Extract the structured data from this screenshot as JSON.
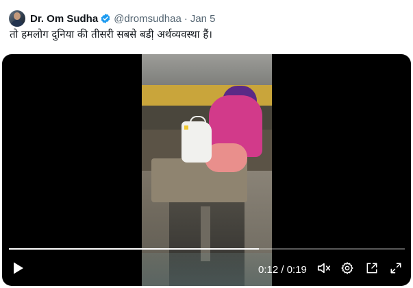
{
  "tweet": {
    "author_name": "Dr. Om Sudha",
    "handle": "@dromsudhaa",
    "separator": "·",
    "date": "Jan 5",
    "text": "तो हमलोग दुनिया की तीसरी सबसे बडी़ अर्थव्यवस्था हैं।"
  },
  "player": {
    "current_time": "0:12",
    "duration": "0:19",
    "time_display": "0:12 / 0:19",
    "progress_fraction": 0.632
  },
  "icons": {
    "verified": "verified-badge-icon",
    "play": "play-icon",
    "mute": "volume-muted-icon",
    "settings": "gear-icon",
    "pip": "picture-in-picture-icon",
    "fullscreen": "fullscreen-icon"
  },
  "colors": {
    "verified_blue": "#1d9bf0",
    "player_bg": "#000000",
    "text_secondary": "#536471"
  }
}
